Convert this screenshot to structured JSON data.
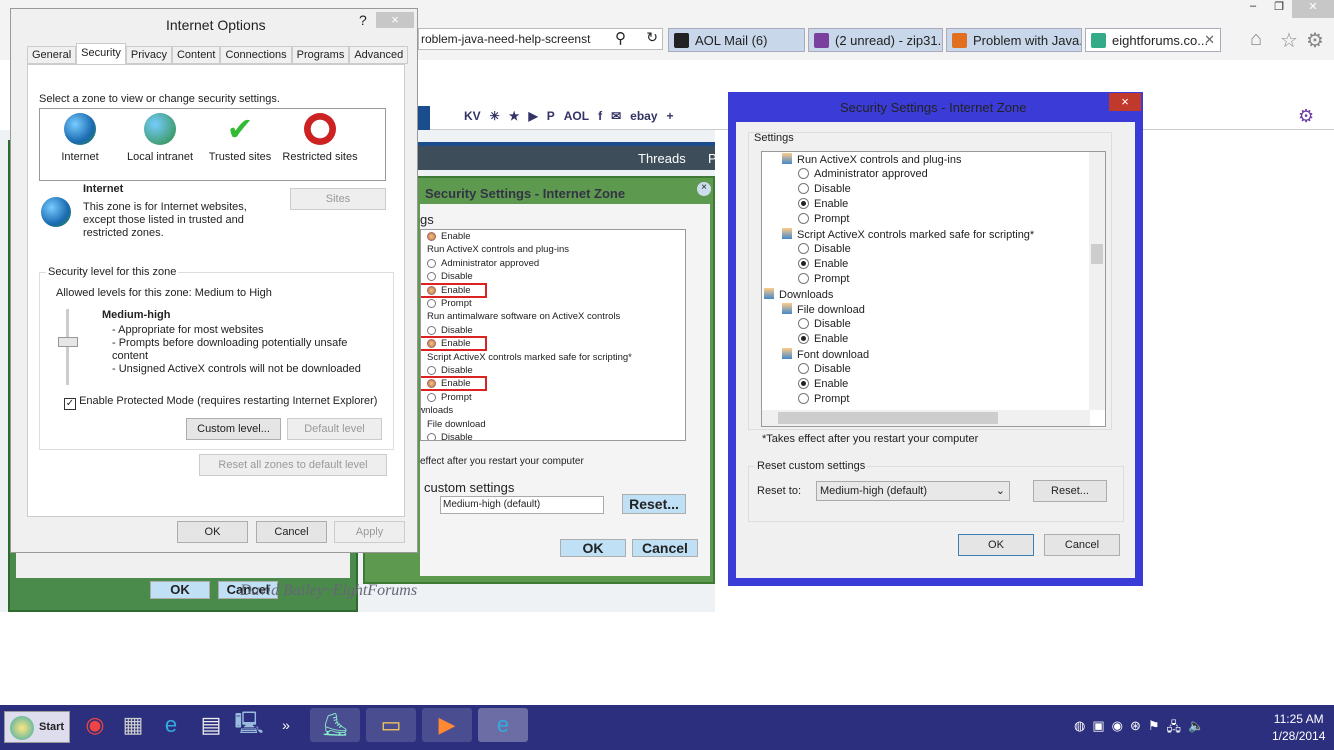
{
  "browser": {
    "address_fragment": "roblem-java-need-help-screenst",
    "tabs": [
      {
        "label": "AOL Mail (6)",
        "color": "#222"
      },
      {
        "label": "(2 unread) - zip31...",
        "color": "#7b3fa0"
      },
      {
        "label": "Problem with Java...",
        "color": "#e07020"
      },
      {
        "label": "eightforums.co...",
        "color": "#3a8"
      }
    ],
    "favorites": [
      "KV",
      "✳",
      "★",
      "▶",
      "P",
      "AOL",
      "f",
      "✉",
      "ebay",
      "+"
    ],
    "forum_nav": "Threads",
    "forum_nav_next": "P",
    "watermark": "David Bailey~EightForums"
  },
  "internet_options": {
    "title": "Internet Options",
    "help": "?",
    "close": "×",
    "tabs": [
      "General",
      "Security",
      "Privacy",
      "Content",
      "Connections",
      "Programs",
      "Advanced"
    ],
    "active_tab": "Security",
    "zone_prompt": "Select a zone to view or change security settings.",
    "zones": [
      {
        "label": "Internet",
        "icon": "globe-icon"
      },
      {
        "label": "Local intranet",
        "icon": "intranet-icon"
      },
      {
        "label": "Trusted sites",
        "icon": "checkmark-icon"
      },
      {
        "label": "Restricted sites",
        "icon": "no-entry-icon"
      }
    ],
    "zone_name": "Internet",
    "zone_desc": "This zone is for Internet websites, except those listed in trusted and restricted zones.",
    "sites_button": "Sites",
    "level_group": "Security level for this zone",
    "allowed_levels": "Allowed levels for this zone: Medium to High",
    "level_name": "Medium-high",
    "level_points": [
      "- Appropriate for most websites",
      "- Prompts before downloading potentially unsafe content",
      "- Unsigned ActiveX controls will not be downloaded"
    ],
    "protected_mode": "Enable Protected Mode (requires restarting Internet Explorer)",
    "protected_mode_checked": true,
    "custom_level": "Custom level...",
    "default_level": "Default level",
    "reset_all": "Reset all zones to default level",
    "ok": "OK",
    "cancel": "Cancel",
    "apply": "Apply"
  },
  "green_dialog": {
    "title": "Security Settings - Internet Zone",
    "settings_label": "gs",
    "items": [
      {
        "t": "Enable",
        "k": "opt",
        "gold": true
      },
      {
        "t": "Run ActiveX controls and plug-ins",
        "k": "head"
      },
      {
        "t": "Administrator approved",
        "k": "opt"
      },
      {
        "t": "Disable",
        "k": "opt"
      },
      {
        "t": "Enable",
        "k": "opt",
        "gold": true,
        "hl": true
      },
      {
        "t": "Prompt",
        "k": "opt"
      },
      {
        "t": "Run antimalware software on ActiveX controls",
        "k": "head"
      },
      {
        "t": "Disable",
        "k": "opt"
      },
      {
        "t": "Enable",
        "k": "opt",
        "gold": true,
        "hl": true
      },
      {
        "t": "Script ActiveX controls marked safe for scripting*",
        "k": "head"
      },
      {
        "t": "Disable",
        "k": "opt"
      },
      {
        "t": "Enable",
        "k": "opt",
        "gold": true,
        "hl": true
      },
      {
        "t": "Prompt",
        "k": "opt"
      },
      {
        "t": "ownloads",
        "k": "cat"
      },
      {
        "t": "File download",
        "k": "head"
      },
      {
        "t": "Disable",
        "k": "opt"
      }
    ],
    "note": "effect after you restart your computer",
    "reset_group": "custom settings",
    "reset_value": "Medium-high (default)",
    "reset": "Reset...",
    "ok": "OK",
    "cancel": "Cancel"
  },
  "blue_dialog": {
    "title": "Security Settings - Internet Zone",
    "close": "×",
    "settings_label": "Settings",
    "items": [
      {
        "t": "Run ActiveX controls and plug-ins",
        "k": "head"
      },
      {
        "t": "Administrator approved",
        "k": "opt"
      },
      {
        "t": "Disable",
        "k": "opt"
      },
      {
        "t": "Enable",
        "k": "opt",
        "on": true
      },
      {
        "t": "Prompt",
        "k": "opt"
      },
      {
        "t": "Script ActiveX controls marked safe for scripting*",
        "k": "head"
      },
      {
        "t": "Disable",
        "k": "opt"
      },
      {
        "t": "Enable",
        "k": "opt",
        "on": true
      },
      {
        "t": "Prompt",
        "k": "opt"
      },
      {
        "t": "Downloads",
        "k": "cat"
      },
      {
        "t": "File download",
        "k": "head"
      },
      {
        "t": "Disable",
        "k": "opt"
      },
      {
        "t": "Enable",
        "k": "opt",
        "on": true
      },
      {
        "t": "Font download",
        "k": "head"
      },
      {
        "t": "Disable",
        "k": "opt"
      },
      {
        "t": "Enable",
        "k": "opt",
        "on": true
      },
      {
        "t": "Prompt",
        "k": "opt"
      }
    ],
    "note": "*Takes effect after you restart your computer",
    "reset_group": "Reset custom settings",
    "reset_to": "Reset to:",
    "reset_value": "Medium-high (default)",
    "reset": "Reset...",
    "ok": "OK",
    "cancel": "Cancel",
    "accent": "#3b3bd8"
  },
  "taskbar": {
    "start": "Start",
    "time": "11:25 AM",
    "date": "1/28/2014",
    "color": "#2b2f7d"
  }
}
